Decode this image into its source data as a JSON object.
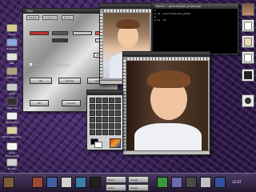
{
  "dialog": {
    "title": "Gtkp",
    "tabs": [
      "Palette",
      "Gradient",
      "Brush"
    ],
    "select_value": "Gtkp",
    "checkbox_label": "Apply colors to all applications",
    "buttons": [
      "OK",
      "Cancel",
      "Apply"
    ],
    "bottom_buttons": [
      "OK",
      "Cancel"
    ]
  },
  "terminal": {
    "title": "Eterm: ~/pictures/kid_photo.jpg",
    "lines": [
      "$",
      "$ cd ~/pictures/kid_photo",
      "$",
      "$ ls -al",
      "$",
      "$",
      "$",
      "$"
    ]
  },
  "desktop_icons": [
    {
      "label": "Home"
    },
    {
      "label": "Netscape"
    },
    {
      "label": "Mail"
    },
    {
      "label": "GIMP Tool"
    },
    {
      "label": "Trash"
    },
    {
      "label": "Terminal"
    },
    {
      "label": "Text Editor"
    },
    {
      "label": "Help"
    },
    {
      "label": "Home Directory"
    },
    {
      "label": "Linux Documents"
    },
    {
      "label": "Printer"
    },
    {
      "label": "Help"
    }
  ],
  "taskbar": {
    "tasks": [
      "Eterm",
      "Gimp",
      "Image",
      "Image"
    ],
    "clock": "12:07"
  },
  "colors": {
    "desktop": "#3b2557",
    "titlebar": "#1e1e1e",
    "swatch_red": "#c0302c",
    "swatch_dark": "#5a5a5a"
  }
}
